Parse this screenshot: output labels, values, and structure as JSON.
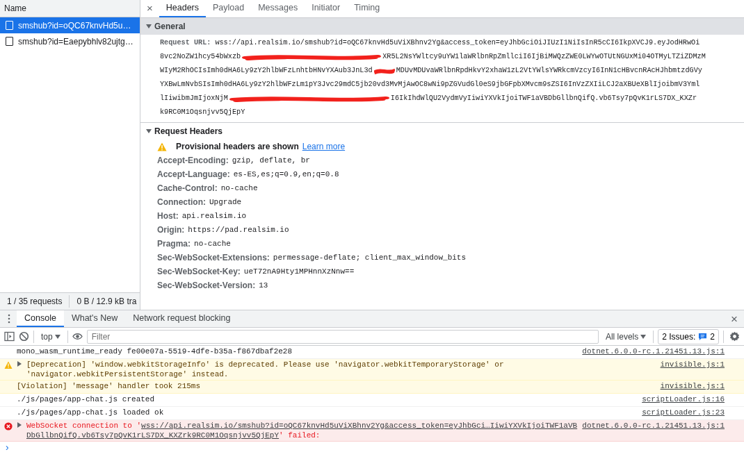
{
  "network": {
    "name_column": "Name",
    "requests": [
      {
        "name": "smshub?id=oQC67knvHd5u…",
        "selected": true
      },
      {
        "name": "smshub?id=Eaepybhlv82ujtg…",
        "selected": false
      }
    ],
    "status": [
      "1 / 35 requests",
      "0 B / 12.9 kB tra"
    ]
  },
  "details": {
    "close": "×",
    "tabs": [
      {
        "label": "Headers",
        "selected": true
      },
      {
        "label": "Payload",
        "selected": false
      },
      {
        "label": "Messages",
        "selected": false
      },
      {
        "label": "Initiator",
        "selected": false
      },
      {
        "label": "Timing",
        "selected": false
      }
    ],
    "general": {
      "title": "General",
      "expanded": true,
      "label": "Request URL:",
      "lines": [
        [
          "wss://api.realsim.io/smshub?id=oQC67knvHd5uViXBhnv2Yg&access_token=eyJhbGciOiJIUzI1NiIsInR5cCI6IkpXVCJ9.eyJodHRwOi"
        ],
        [
          "8vc2NoZW1hcy54bWxzb",
          "XR5L2NsYWltcy9uYW1laWRlbnRpZmllciI6IjBiMWQzZWE0LWYwOTUtNGUxMi04OTMyLTZiZDMzM"
        ],
        [
          "WIyM2RhOCIsImh0dHA6Ly9zY2hlbWFzLnhtbHNvYXAub3JnL3d",
          "MDUvMDUvaWRlbnRpdHkvY2xhaW1zL2VtYWlsYWRkcmVzcyI6InN1cHBvcnRAcHJhbmtzdGVy"
        ],
        [
          "YXBwLmNvbSIsImh0dHA6Ly9zY2hlbWFzLm1pY3Jvc29mdC5jb20vd3MvMjAwOC8wNi9pZGVudGl0eS9jbGFpbXMvcm9sZSI6InVzZXIiLCJ2aXBUeXBlIjoibmV3Yml"
        ],
        [
          "lIiwibmJmIjoxNjM",
          "I6IkIhdWlQU2VydmVyIiwiYXVkIjoiTWF1aVBDbGllbnQifQ.vb6Tsy7pQvK1rLS7DX_KXZr"
        ],
        [
          "k9RC0M1Oqsnjvv5QjEpY"
        ]
      ]
    },
    "request_headers": {
      "title": "Request Headers",
      "expanded": true,
      "notice": {
        "text": "Provisional headers are shown",
        "link": "Learn more"
      },
      "headers": [
        {
          "name": "Accept-Encoding:",
          "value": "gzip, deflate, br"
        },
        {
          "name": "Accept-Language:",
          "value": "es-ES,es;q=0.9,en;q=0.8"
        },
        {
          "name": "Cache-Control:",
          "value": "no-cache"
        },
        {
          "name": "Connection:",
          "value": "Upgrade"
        },
        {
          "name": "Host:",
          "value": "api.realsim.io"
        },
        {
          "name": "Origin:",
          "value": "https://pad.realsim.io"
        },
        {
          "name": "Pragma:",
          "value": "no-cache"
        },
        {
          "name": "Sec-WebSocket-Extensions:",
          "value": "permessage-deflate; client_max_window_bits"
        },
        {
          "name": "Sec-WebSocket-Key:",
          "value": "ueT72nA9Hty1MPHnnXzNnw=="
        },
        {
          "name": "Sec-WebSocket-Version:",
          "value": "13"
        }
      ]
    }
  },
  "drawer": {
    "tabs": [
      {
        "label": "Console",
        "selected": true
      },
      {
        "label": "What's New",
        "selected": false
      },
      {
        "label": "Network request blocking",
        "selected": false
      }
    ],
    "close": "×",
    "toolbar": {
      "context": "top",
      "filter_placeholder": "Filter",
      "levels": "All levels",
      "issues_label": "2 Issues:",
      "issues_count": "2"
    },
    "messages": [
      {
        "kind": "info",
        "expandable": false,
        "text": "mono_wasm_runtime_ready fe00e07a-5519-4dfe-b35a-f867dbaf2e28",
        "source": "dotnet.6.0.0-rc.1.21451.13.js:1"
      },
      {
        "kind": "warning",
        "expandable": true,
        "text": "[Deprecation] 'window.webkitStorageInfo' is deprecated. Please use 'navigator.webkitTemporaryStorage' or 'navigator.webkitPersistentStorage' instead.",
        "source": "invisible.js:1"
      },
      {
        "kind": "violation",
        "expandable": false,
        "text": "[Violation] 'message' handler took 215ms",
        "source": "invisible.js:1"
      },
      {
        "kind": "info",
        "expandable": false,
        "text": "./js/pages/app-chat.js created",
        "source": "scriptLoader.js:16"
      },
      {
        "kind": "info",
        "expandable": false,
        "text": "./js/pages/app-chat.js loaded ok",
        "source": "scriptLoader.js:23"
      },
      {
        "kind": "error",
        "expandable": true,
        "text": "WebSocket connection to '",
        "links": [
          "wss://api.realsim.io/smshub?id=oQC67knvHd5uViXBhnv2Yg&access_token=eyJhbGci…IiwiYXVkIjoiTWF1aVB",
          "DbGllbnQifQ.vb6Tsy7pQvK1rLS7DX_KXZrk9RC0M1Oqsnjvv5QjEpY"
        ],
        "suffix": "' failed:",
        "source": "dotnet.6.0.0-rc.1.21451.13.js:1"
      }
    ],
    "prompt": "›"
  }
}
